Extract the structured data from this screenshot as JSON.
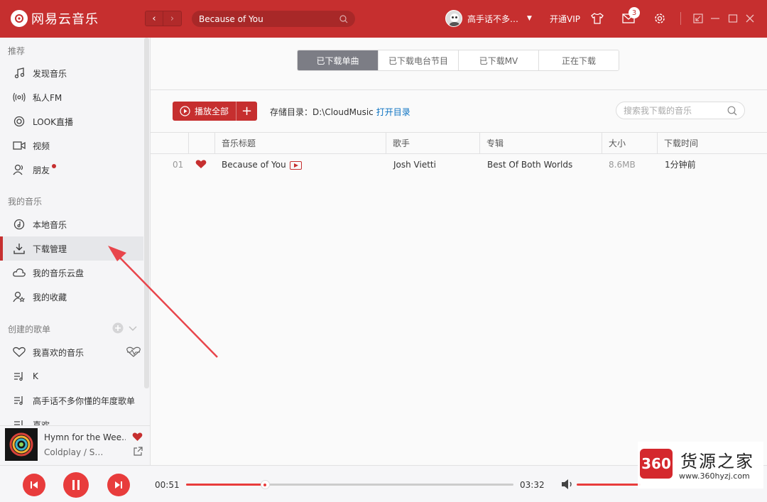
{
  "app": {
    "title": "网易云音乐"
  },
  "header": {
    "back_label": "‹",
    "forward_label": "›",
    "search_value": "Because of You",
    "user_name": "高手话不多…",
    "vip_label": "开通VIP",
    "message_count": "3"
  },
  "sidebar": {
    "sections": [
      {
        "title": "推荐"
      },
      {
        "title": "我的音乐"
      },
      {
        "title": "创建的歌单"
      }
    ],
    "items": [
      {
        "label": "发现音乐",
        "icon": "music-note-icon"
      },
      {
        "label": "私人FM",
        "icon": "radio-icon"
      },
      {
        "label": "LOOK直播",
        "icon": "live-icon"
      },
      {
        "label": "视频",
        "icon": "video-icon"
      },
      {
        "label": "朋友",
        "icon": "friends-icon"
      },
      {
        "label": "本地音乐",
        "icon": "local-music-icon"
      },
      {
        "label": "下载管理",
        "icon": "download-icon"
      },
      {
        "label": "我的音乐云盘",
        "icon": "cloud-icon"
      },
      {
        "label": "我的收藏",
        "icon": "favorites-icon"
      },
      {
        "label": "我喜欢的音乐",
        "icon": "heart-icon"
      },
      {
        "label": "K",
        "icon": "playlist-icon"
      },
      {
        "label": "高手话不多你懂的年度歌单",
        "icon": "playlist-icon"
      },
      {
        "label": "喜欢",
        "icon": "playlist-icon"
      }
    ]
  },
  "now_playing": {
    "title": "Hymn for the Wee…",
    "artist": "Coldplay / S…"
  },
  "main": {
    "tabs": [
      {
        "label": "已下载单曲",
        "active": true
      },
      {
        "label": "已下载电台节目",
        "active": false
      },
      {
        "label": "已下载MV",
        "active": false
      },
      {
        "label": "正在下载",
        "active": false
      }
    ],
    "play_all_label": "播放全部",
    "play_all_plus": "+",
    "storage_dir_label": "存储目录：D:\\CloudMusic",
    "open_dir_label": "打开目录",
    "search_placeholder": "搜索我下载的音乐",
    "columns": [
      "音乐标题",
      "歌手",
      "专辑",
      "大小",
      "下载时间"
    ],
    "rows": [
      {
        "index": "01",
        "title": "Because of You",
        "artist": "Josh Vietti",
        "album": "Best Of Both Worlds",
        "size": "8.6MB",
        "time": "1分钟前"
      }
    ]
  },
  "player": {
    "current_time": "00:51",
    "total_time": "03:32",
    "progress": 0.24
  },
  "watermark": {
    "badge": "360",
    "title": "货源之家",
    "url": "www.360hyzj.com"
  },
  "colors": {
    "brand": "#c62f2f",
    "accent": "#e83c3c",
    "link": "#0c73c2"
  }
}
